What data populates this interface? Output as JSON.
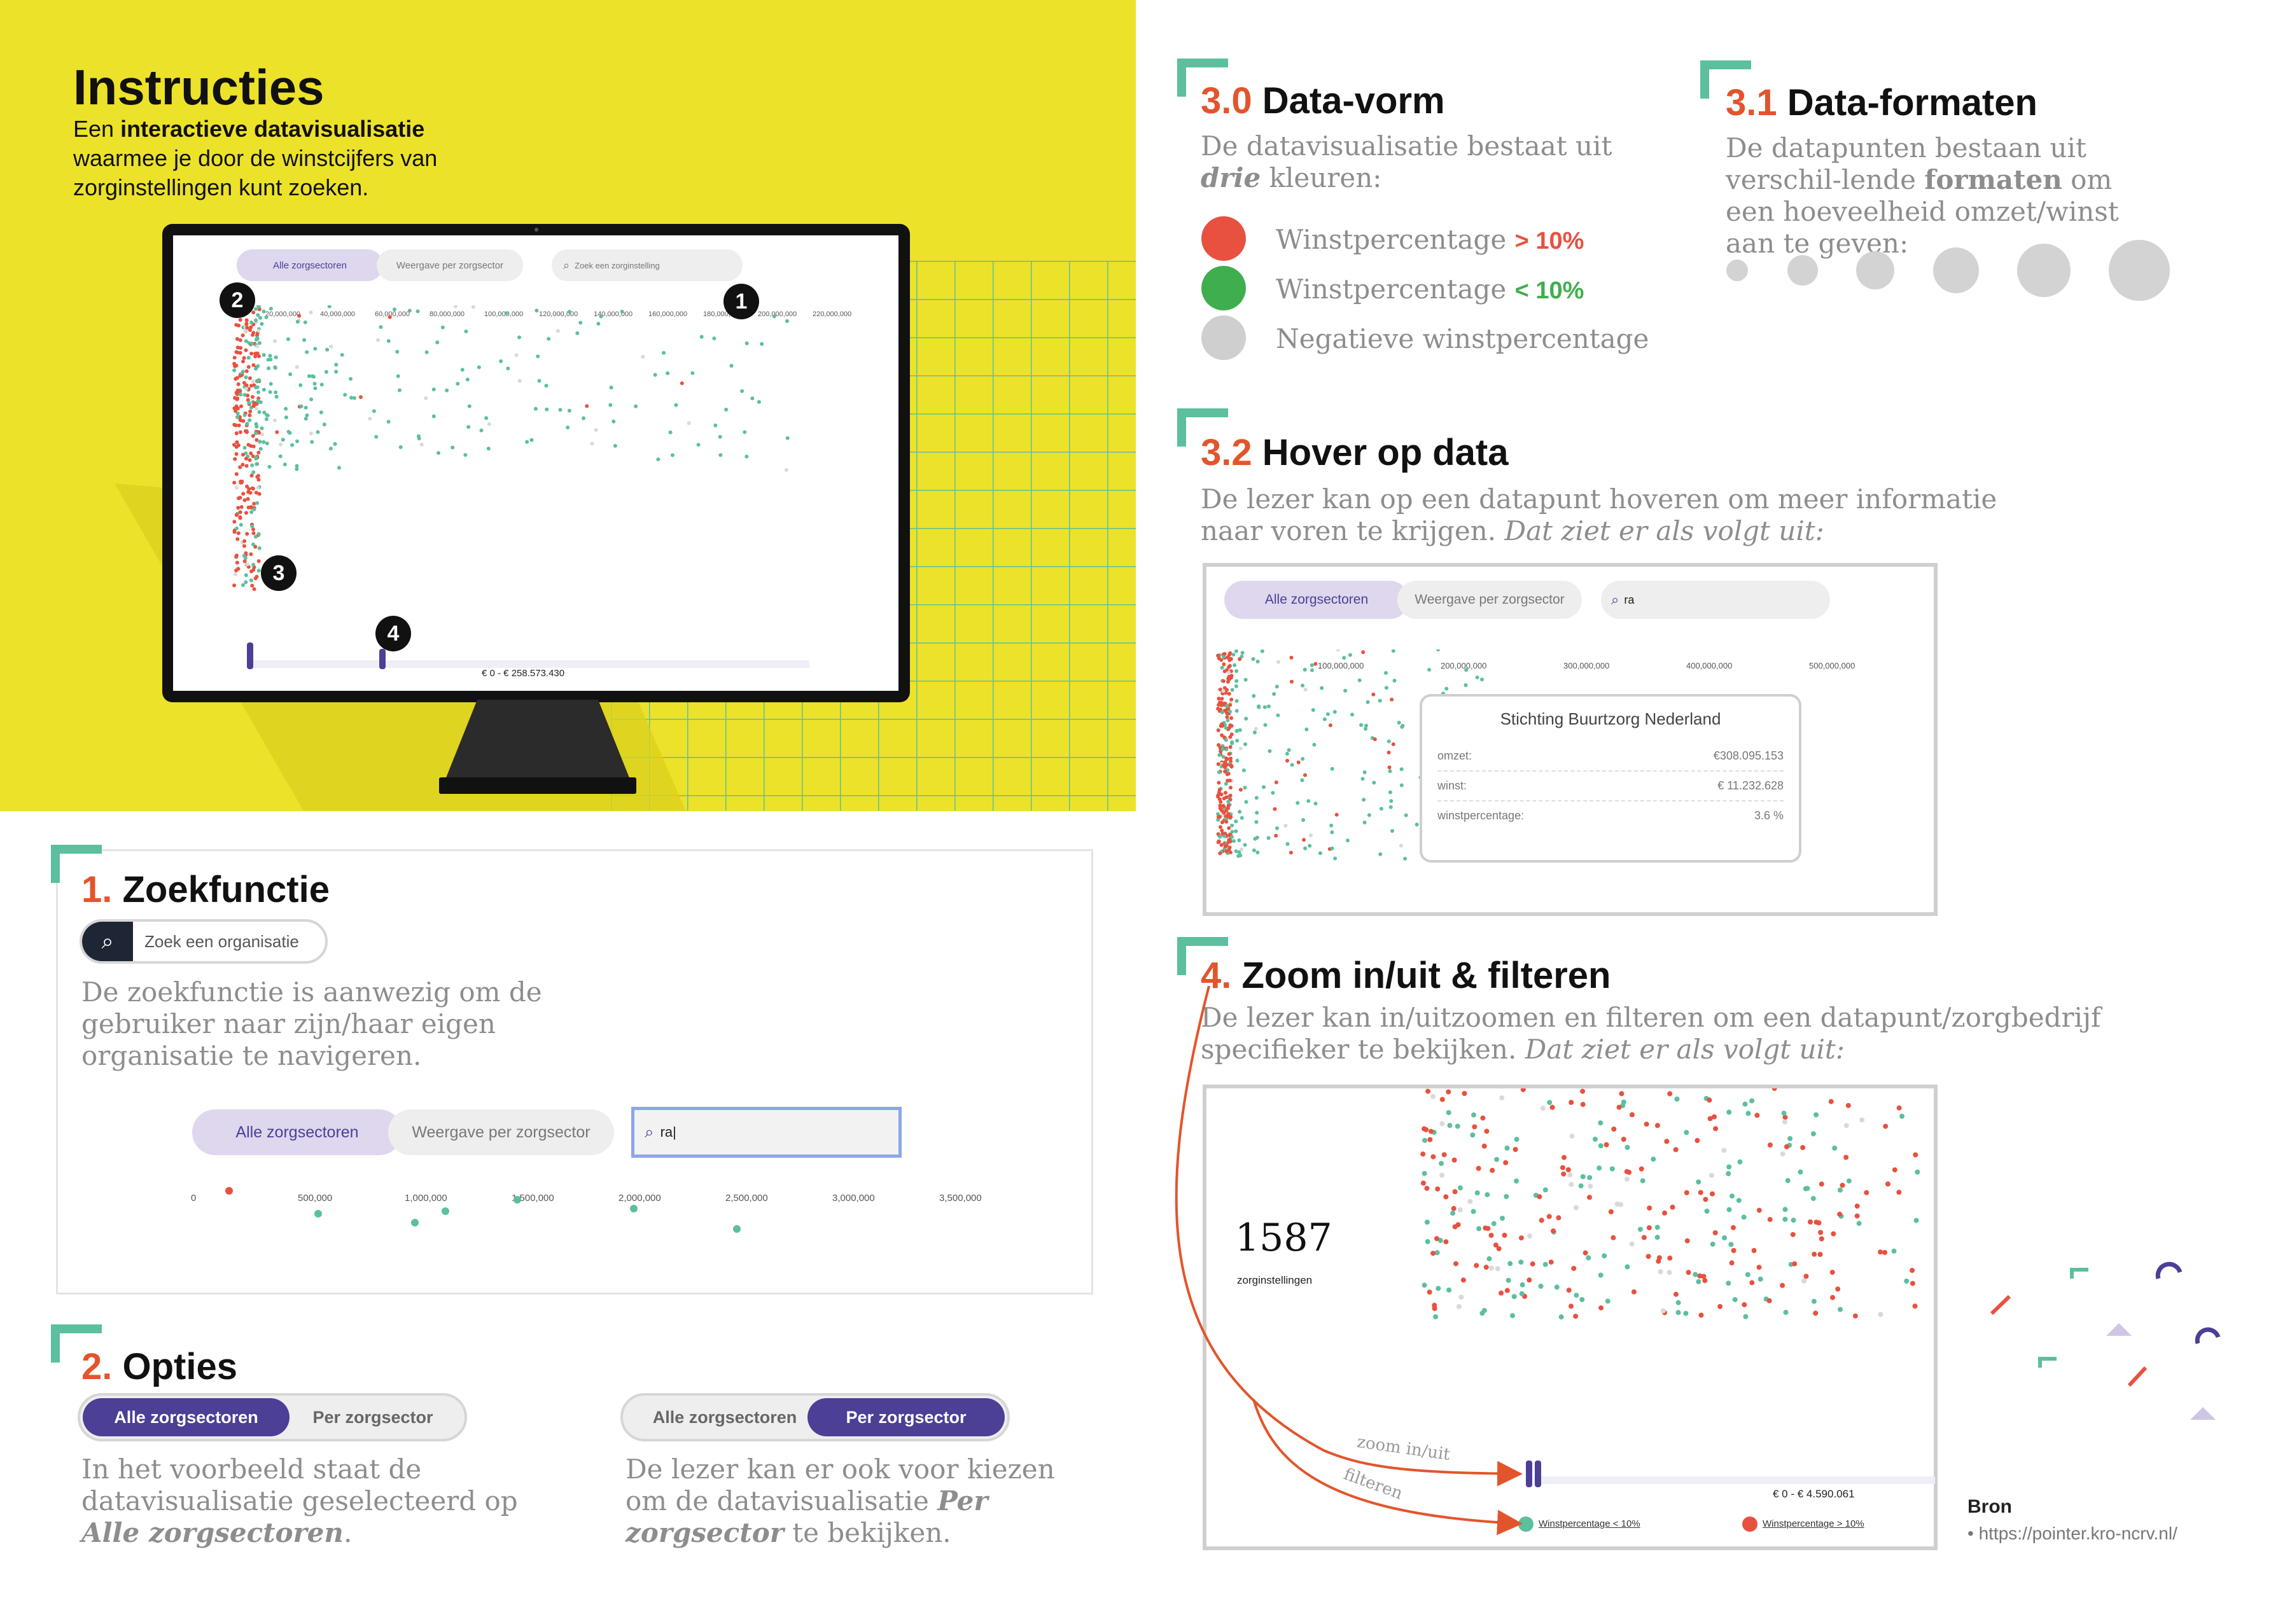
{
  "header": {
    "title": "Instructies",
    "intro_pre": "Een ",
    "intro_bold": "interactieve datavisualisatie",
    "intro_post": "waarmee je door de winstcijfers van zorginstellingen kunt zoeken."
  },
  "monitor": {
    "tab_all": "Alle zorgsectoren",
    "tab_per": "Weergave per zorgsector",
    "search_placeholder": "Zoek een zorginstelling",
    "ticks": [
      "20,000,000",
      "40,000,000",
      "60,000,000",
      "80,000,000",
      "100,000,000",
      "120,000,000",
      "140,000,000",
      "160,000,000",
      "180,000,000",
      "200,000,000",
      "220,000,000"
    ],
    "range_label": "€ 0 - € 258.573.430",
    "markers": [
      "1",
      "2",
      "3",
      "4"
    ]
  },
  "sec1": {
    "num": "1.",
    "title": "Zoekfunctie",
    "search_placeholder": "Zoek een organisatie",
    "desc": "De zoekfunctie is aanwezig om de gebruiker naar zijn/haar eigen organisatie te navigeren.",
    "tab_all": "Alle zorgsectoren",
    "tab_per": "Weergave per zorgsector",
    "search_value": "ra",
    "ticks": [
      "0",
      "500,000",
      "1,000,000",
      "1,500,000",
      "2,000,000",
      "2,500,000",
      "3,000,000",
      "3,500,000"
    ]
  },
  "sec2": {
    "num": "2.",
    "title": "Opties",
    "btn_all": "Alle zorgsectoren",
    "btn_per": "Per zorgsector",
    "desc_left_1": "In het voorbeeld staat de datavisualisatie geselecteerd op",
    "desc_left_em": "Alle zorgsectoren",
    "desc_left_2": ".",
    "desc_right_1": "De lezer kan er ook voor kiezen om de datavisualisatie",
    "desc_right_em": "Per zorgsector",
    "desc_right_2": " te bekijken."
  },
  "sec30": {
    "num": "3.0",
    "title": "Data-vorm",
    "desc_1": "De datavisualisatie bestaat uit",
    "desc_em": "drie",
    "desc_2": " kleuren:",
    "legend": [
      {
        "label": "Winstpercentage",
        "tag": "> 10%",
        "color": "#e8513f",
        "tag_color": "#e8513f"
      },
      {
        "label": "Winstpercentage",
        "tag": "< 10%",
        "color": "#3fae4e",
        "tag_color": "#3fae4e"
      },
      {
        "label": "Negatieve winstpercentage",
        "tag": "",
        "color": "#cfcfcf",
        "tag_color": "#cfcfcf"
      }
    ]
  },
  "sec31": {
    "num": "3.1",
    "title": "Data-formaten",
    "desc_1": "De datapunten bestaan uit verschil-lende ",
    "desc_bold": "formaten",
    "desc_2": " om een hoeveelheid omzet/winst aan te geven:"
  },
  "sec32": {
    "num": "3.2",
    "title": "Hover op data",
    "desc_1": "De lezer kan op een datapunt hoveren om meer informatie naar voren te krijgen. ",
    "desc_em": "Dat ziet er als volgt uit:",
    "tab_all": "Alle zorgsectoren",
    "tab_per": "Weergave per zorgsector",
    "search_value": "ra",
    "ticks": [
      "100,000,000",
      "200,000,000",
      "300,000,000",
      "400,000,000",
      "500,000,000"
    ],
    "tooltip": {
      "title": "Stichting Buurtzorg Nederland",
      "rows": [
        {
          "label": "omzet:",
          "value": "€308.095.153"
        },
        {
          "label": "winst:",
          "value": "€ 11.232.628"
        },
        {
          "label": "winstpercentage:",
          "value": "3.6 %"
        }
      ]
    }
  },
  "sec4": {
    "num": "4.",
    "title": "Zoom in/uit & filteren",
    "desc_1": "De lezer kan in/uitzoomen en filteren om een datapunt/zorgbedrijf specifieker te bekijken. ",
    "desc_em": "Dat ziet er als volgt uit:",
    "count": "1587",
    "count_label": "zorginstellingen",
    "arrow_zoom": "zoom in/uit",
    "arrow_filter": "filteren",
    "range_label": "€ 0 - € 4.590.061",
    "legend_lt": "Winstpercentage < 10%",
    "legend_gt": "Winstpercentage > 10%"
  },
  "source": {
    "title": "Bron",
    "url": "• https://pointer.kro-ncrv.nl/"
  },
  "colors": {
    "yellow": "#ece229",
    "teal": "#5cbf9f",
    "red": "#e8513f",
    "green": "#3fae4e",
    "grey": "#cfcfcf",
    "orange": "#e2552c",
    "purple": "#4b3f96",
    "lavender": "#ded7ee"
  }
}
